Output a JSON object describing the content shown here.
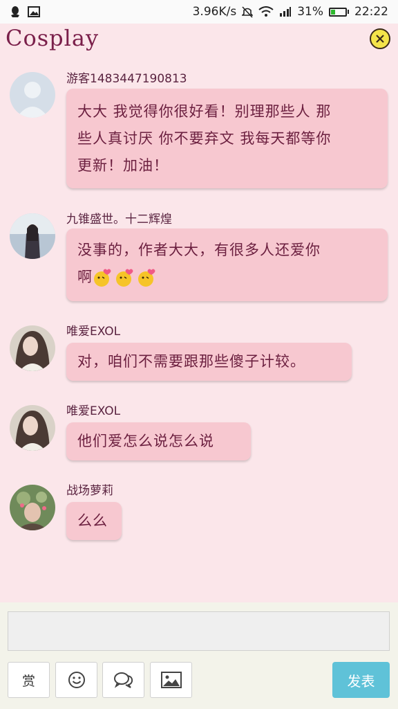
{
  "status_bar": {
    "speed": "3.96K/s",
    "battery": "31%",
    "time": "22:22",
    "battery_level": 0.31,
    "icons": [
      "qq-icon",
      "image-icon",
      "mute-icon",
      "wifi-icon",
      "signal-icon",
      "battery-icon"
    ]
  },
  "header": {
    "title": "Cosplay",
    "close_icon": "close-icon",
    "close_color": "#f4e44a"
  },
  "messages": [
    {
      "user": "游客1483447190813",
      "lines": [
        "大大 我觉得你很好看！别理那些人 那",
        "些人真讨厌 你不要弃文 我每天都等你",
        "更新！加油！"
      ],
      "avatar": "default-avatar"
    },
    {
      "user": "九锥盛世。十二辉煌",
      "lines": [
        "没事的，作者大大，有很多人还爱你",
        "啊"
      ],
      "emoji": [
        "kiss-emoji",
        "kiss-emoji",
        "kiss-emoji"
      ],
      "avatar": "photo-avatar"
    },
    {
      "user": "唯爱EXOL",
      "lines": [
        "对，咱们不需要跟那些傻子计较。"
      ],
      "avatar": "photo-avatar"
    },
    {
      "user": "唯爱EXOL",
      "lines": [
        " 他们爱怎么说怎么说"
      ],
      "avatar": "photo-avatar"
    },
    {
      "user": "战场萝莉",
      "lines": [
        "么么"
      ],
      "avatar": "photo-avatar"
    }
  ],
  "composer": {
    "input_value": "",
    "reward_label": "赏",
    "emoji_icon": "smiley-icon",
    "chat_icon": "chat-bubbles-icon",
    "image_icon": "picture-icon",
    "send_label": "发表",
    "send_color": "#5fc2d8"
  }
}
